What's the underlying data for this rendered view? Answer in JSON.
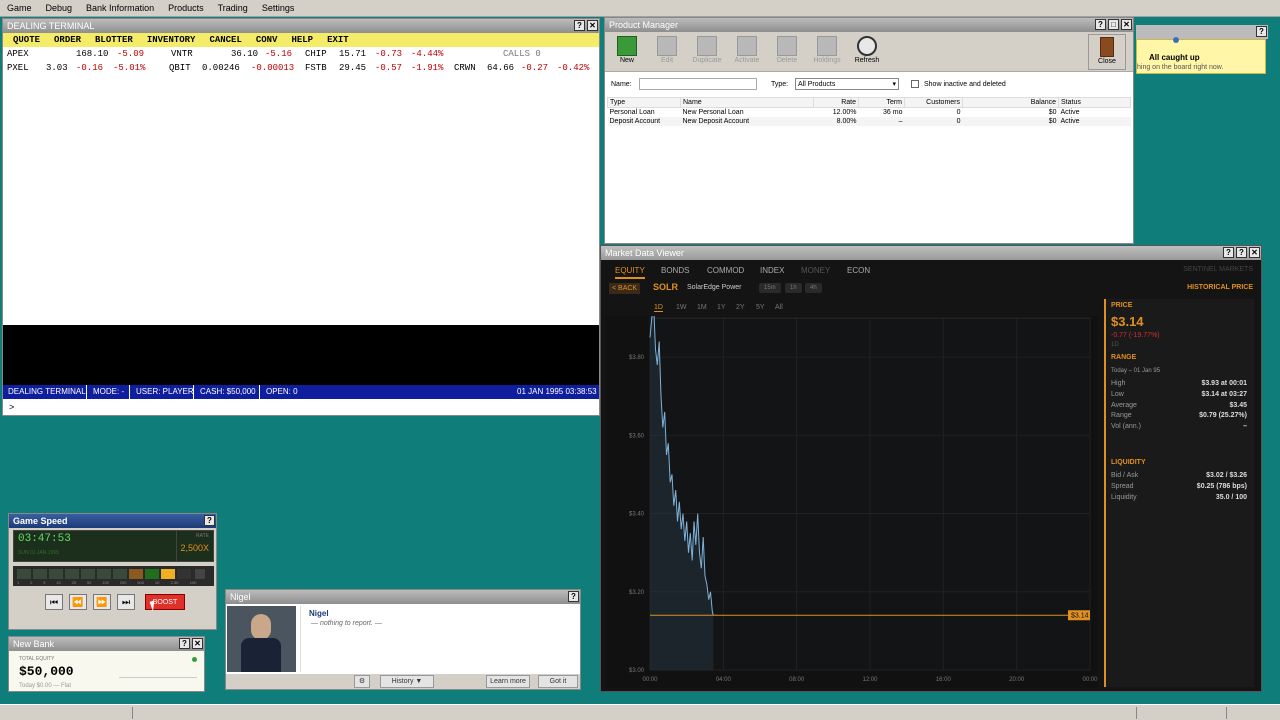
{
  "menubar": {
    "items": [
      "Game",
      "Debug",
      "Bank Information",
      "Products",
      "Trading",
      "Settings"
    ]
  },
  "dealing": {
    "title": "DEALING TERMINAL",
    "menu": [
      "QUOTE",
      "ORDER",
      "BLOTTER",
      "INVENTORY",
      "CANCEL",
      "CONV",
      "HELP",
      "EXIT"
    ],
    "row1": {
      "a_sym": "APEX",
      "a_px": "168.10",
      "a_chg": "-5.09",
      "b_sym": "VNTR",
      "b_px": "36.10",
      "b_chg": "-5.16",
      "c_sym": "CHIP",
      "c_px": "15.71",
      "c_chg": "-0.73",
      "c_pct": "-4.44%",
      "calls": "CALLS 0"
    },
    "row2": {
      "a_sym": "PXEL",
      "a_px": "3.03",
      "a_chg": "-0.16",
      "a_pct": "-5.01%",
      "b_sym": "QBIT",
      "b_px": "0.00246",
      "b_chg": "-0.00013",
      "c_sym": "FSTB",
      "c_px": "29.45",
      "c_chg": "-0.57",
      "c_pct": "-1.91%",
      "d_sym": "CRWN",
      "d_px": "64.66",
      "d_chg": "-0.27",
      "d_pct": "-0.42%"
    },
    "status": {
      "name": "DEALING TERMINAL",
      "mode": "MODE: -",
      "user": "USER: PLAYER",
      "cash": "CASH: $50,000",
      "open": "OPEN: 0",
      "datetime": "01 JAN 1995  03:38:53"
    },
    "prompt": ">"
  },
  "product": {
    "title": "Product Manager",
    "tools": [
      "New",
      "Edit",
      "Duplicate",
      "Activate",
      "Delete",
      "Holdings",
      "Refresh"
    ],
    "close": "Close",
    "name_label": "Name:",
    "type_label": "Type:",
    "type_value": "All Products",
    "show_inactive": "Show inactive and deleted",
    "columns": [
      "Type",
      "Name",
      "Rate",
      "Term",
      "Customers",
      "Balance",
      "Status"
    ],
    "rows": [
      [
        "Personal Loan",
        "New Personal Loan",
        "12.00%",
        "36 mo",
        "0",
        "$0",
        "Active"
      ],
      [
        "Deposit Account",
        "New Deposit Account",
        "8.00%",
        "–",
        "0",
        "$0",
        "Active"
      ]
    ]
  },
  "notification": {
    "title": "All caught up",
    "body": "hing on the board right now."
  },
  "market": {
    "title": "Market Data Viewer",
    "tabs": [
      "EQUITY",
      "BONDS",
      "COMMOD",
      "INDEX",
      "MONEY",
      "ECON"
    ],
    "brand": "SENTINEL MARKETS",
    "back": "< BACK",
    "ticker": "SOLR",
    "company": "SolarEdge Power",
    "intervals": [
      "15m",
      "1h",
      "4h"
    ],
    "ranges": [
      "1D",
      "1W",
      "1M",
      "1Y",
      "2Y",
      "5Y",
      "All"
    ],
    "hist": "HISTORICAL PRICE",
    "price_hd": "PRICE",
    "price": "$3.14",
    "change": "-0.77 (-19.77%)",
    "period": "1D",
    "range_hd": "RANGE",
    "range_sub": "Today – 01 Jan 95",
    "high_l": "High",
    "high_v": "$3.93  at 00:01",
    "low_l": "Low",
    "low_v": "$3.14  at 03:27",
    "avg_l": "Average",
    "avg_v": "$3.45",
    "rng_l": "Range",
    "rng_v": "$0.79  (25.27%)",
    "vol_l": "Vol (ann.)",
    "vol_v": "–",
    "liq_hd": "LIQUIDITY",
    "ba_l": "Bid / Ask",
    "ba_v": "$3.02 / $3.26",
    "sp_l": "Spread",
    "sp_v": "$0.25  (786 bps)",
    "lq_l": "Liquidity",
    "lq_v": "35.0 / 100",
    "last_tag": "$3.14"
  },
  "chart_data": {
    "type": "line",
    "yticks": [
      "$3.80",
      "$3.60",
      "$3.40",
      "$3.20",
      "$3.00"
    ],
    "xticks": [
      "00:00",
      "04:00",
      "08:00",
      "12:00",
      "16:00",
      "20:00",
      "00:00"
    ],
    "ylim": [
      3.0,
      3.9
    ],
    "x_hours": [
      0.0,
      0.1,
      0.2,
      0.3,
      0.4,
      0.5,
      0.6,
      0.7,
      0.8,
      0.9,
      1.0,
      1.1,
      1.2,
      1.3,
      1.4,
      1.5,
      1.6,
      1.7,
      1.8,
      1.9,
      2.0,
      2.1,
      2.2,
      2.3,
      2.4,
      2.5,
      2.6,
      2.7,
      2.8,
      2.9,
      3.0,
      3.1,
      3.2,
      3.3,
      3.4,
      3.45
    ],
    "y": [
      3.85,
      3.9,
      3.93,
      3.82,
      3.78,
      3.84,
      3.7,
      3.62,
      3.66,
      3.55,
      3.58,
      3.48,
      3.5,
      3.42,
      3.46,
      3.38,
      3.43,
      3.36,
      3.4,
      3.33,
      3.38,
      3.3,
      3.35,
      3.28,
      3.38,
      3.32,
      3.4,
      3.3,
      3.26,
      3.34,
      3.24,
      3.22,
      3.18,
      3.2,
      3.15,
      3.14
    ],
    "last": 3.14
  },
  "gamespeed": {
    "title": "Game Speed",
    "time": "03:47:53",
    "date": "SUN 01 JAN 1995",
    "rate_label": "RATE",
    "rate": "2,500X",
    "boost": "BOOST",
    "ticks": [
      "1",
      "2",
      "5",
      "10",
      "25",
      "50",
      "100",
      "250",
      "500",
      "1K",
      "2.5K",
      "10K"
    ]
  },
  "newbank": {
    "title": "New Bank",
    "label": "TOTAL EQUITY",
    "value": "$50,000",
    "sub": "Today $0.00 — Flat"
  },
  "nigel": {
    "title": "Nigel",
    "name": "Nigel",
    "msg": "— nothing to report. —",
    "history": "History ▼",
    "learn": "Learn more",
    "got": "Got it"
  }
}
